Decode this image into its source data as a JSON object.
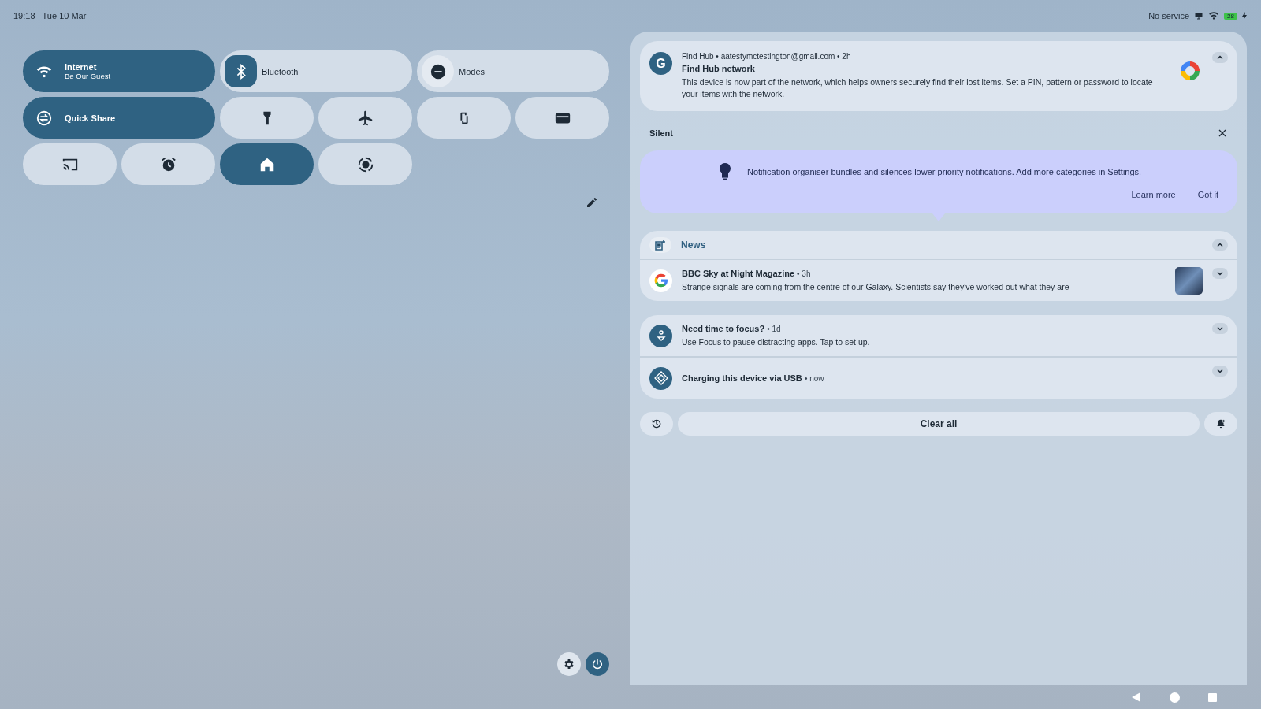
{
  "status_bar": {
    "time": "19:18",
    "date": "Tue 10 Mar",
    "carrier": "No service",
    "battery": "28"
  },
  "tiles": [
    {
      "kind": "wide",
      "label": "Internet",
      "sub": "Be Our Guest",
      "on": true,
      "icon_active": true
    },
    {
      "kind": "wide",
      "label": "Bluetooth",
      "on": false,
      "icon_active": true
    },
    {
      "kind": "wide",
      "label": "Modes",
      "on": false,
      "icon_active": false
    },
    {
      "kind": "wide",
      "label": "Quick Share",
      "on": true,
      "icon_active": true
    },
    {
      "kind": "small",
      "on": false
    },
    {
      "kind": "small",
      "on": false
    },
    {
      "kind": "small",
      "on": false
    },
    {
      "kind": "small",
      "on": false
    },
    {
      "kind": "small",
      "on": false
    },
    {
      "kind": "small",
      "on": false
    },
    {
      "kind": "small",
      "on": true
    },
    {
      "kind": "small",
      "on": false
    }
  ],
  "top_notification": {
    "header": "Find Hub • aatestymctestington@gmail.com • 2h",
    "avatar": "G",
    "title": "Find Hub network",
    "body": "This device is now part of the network, which helps owners securely find their lost items. Set a PIN, pattern or password to locate your items with the network.",
    "expanded": true
  },
  "silent_header": "Silent",
  "organiser": {
    "text": "Notification organiser bundles and silences lower priority notifications. Add more categories in Settings.",
    "actions": [
      "Learn more",
      "Got it"
    ]
  },
  "news_group": {
    "title": "News",
    "expanded": true,
    "items": [
      {
        "source": "BBC Sky at Night Magazine",
        "time": "• 3h",
        "body": "Strange signals are coming from the centre of our Galaxy. Scientists say they've worked out what they are",
        "expanded": false
      }
    ]
  },
  "notifications": [
    {
      "title": "Need time to focus?",
      "time": "• 1d",
      "body": "Use Focus to pause distracting apps. Tap to set up.",
      "expanded": false
    },
    {
      "title": "Charging this device via USB",
      "time": "• now",
      "expanded": false
    }
  ],
  "footer": {
    "clear_all": "Clear all"
  }
}
